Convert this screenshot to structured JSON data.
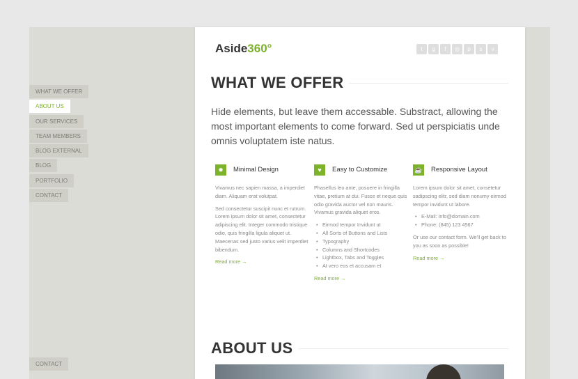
{
  "nav": {
    "items": [
      "WHAT WE OFFER",
      "ABOUT US",
      "OUR SERVICES",
      "TEAM MEMBERS",
      "BLOG EXTERNAL",
      "BLOG",
      "PORTFOLIO",
      "CONTACT"
    ],
    "active": "ABOUT US",
    "bottom": "CONTACT"
  },
  "logo": {
    "text": "Aside",
    "suffix": "360°"
  },
  "social": [
    "twitter-icon",
    "google-plus-icon",
    "facebook-icon",
    "dribbble-icon",
    "pinterest-icon",
    "skype-icon",
    "vimeo-icon"
  ],
  "offer": {
    "title": "WHAT WE OFFER",
    "lead": "Hide elements, but leave them accessable. Substract, allowing the most important elements to come forward. Sed ut perspiciatis unde omnis voluptatem iste natus.",
    "col1": {
      "icon": "lightbulb-icon",
      "title": "Minimal Design",
      "p1": "Vivamus nec sapien massa, a imperdiet diam. Aliquam erat volutpat.",
      "p2": "Sed consectetur suscipit nunc et rutrum. Lorem ipsum dolor sit amet, consectetur adipiscing elit. Integer commodo tristique odio, quis fringilla ligula aliquet ut. Maecenas sed justo varius velit imperdiet bibendum.",
      "link": "Read more →"
    },
    "col2": {
      "icon": "heart-icon",
      "title": "Easy to Customize",
      "p1": "Phasellus leo ante, posuere in fringilla vitae, pretium at dui. Fusce et neque quis odio gravida auctor vel non mauris. Vivamus gravida aliquet eros.",
      "list": [
        "Eirmod tempor Invidunt ut",
        "All Sorts of Buttons and Lists",
        "Typography",
        "Columns and Shortcodes",
        "Lightbox, Tabs and Toggles",
        "At vero eos et accusam et"
      ],
      "link": "Read more →"
    },
    "col3": {
      "icon": "mug-icon",
      "title": "Responsive Layout",
      "p1": "Lorem ipsum dolor sit amet, consetetur sadipscing elitr, sed diam nonumy eirmod tempor invidunt ut labore.",
      "list": [
        "E-Mail: info@domain.com",
        "Phone: (845) 123 4567"
      ],
      "p2": "Or use our contact form. We'll get back to you as soon as possible!",
      "link": "Read more →"
    }
  },
  "about": {
    "title": "ABOUT US"
  },
  "colors": {
    "accent": "#7cb32b",
    "sidebar": "#dcdcd6",
    "nav_bg": "#cfcfc8"
  }
}
